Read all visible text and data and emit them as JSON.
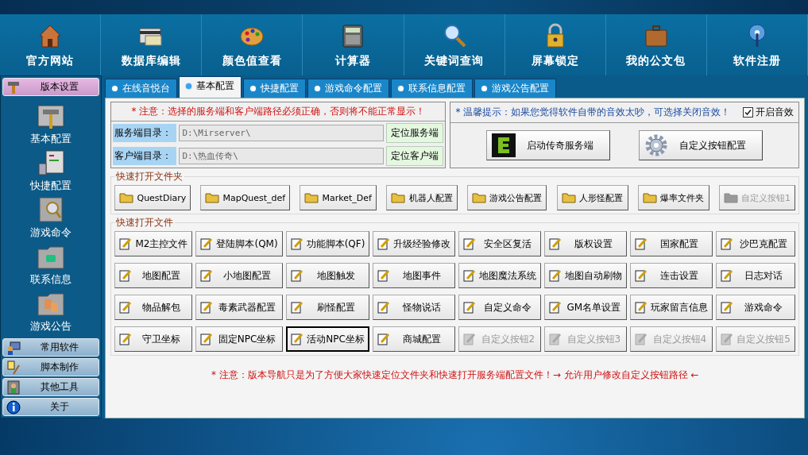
{
  "toolbar": [
    {
      "label": "官方网站",
      "kind": "house"
    },
    {
      "label": "数据库编辑",
      "kind": "card"
    },
    {
      "label": "颜色值查看",
      "kind": "palette"
    },
    {
      "label": "计算器",
      "kind": "calculator"
    },
    {
      "label": "关键词查询",
      "kind": "magnifier"
    },
    {
      "label": "屏幕锁定",
      "kind": "lock"
    },
    {
      "label": "我的公文包",
      "kind": "briefcase"
    },
    {
      "label": "软件注册",
      "kind": "antenna"
    }
  ],
  "sidebar": {
    "groups": [
      {
        "label": "版本设置",
        "kind": "hammer",
        "expanded": true,
        "items": [
          {
            "label": "基本配置",
            "kind": "hammer"
          },
          {
            "label": "快捷配置",
            "kind": "panel"
          },
          {
            "label": "游戏命令",
            "kind": "find"
          },
          {
            "label": "联系信息",
            "kind": "phone"
          },
          {
            "label": "游戏公告",
            "kind": "faces"
          }
        ]
      },
      {
        "label": "常用软件",
        "kind": "computer",
        "expanded": false
      },
      {
        "label": "脚本制作",
        "kind": "note",
        "expanded": false
      },
      {
        "label": "其他工具",
        "kind": "person",
        "expanded": false
      },
      {
        "label": "关于",
        "kind": "info",
        "expanded": false
      }
    ]
  },
  "tabs": [
    {
      "label": "在线音悦台",
      "selected": false
    },
    {
      "label": "基本配置",
      "selected": true
    },
    {
      "label": "快捷配置",
      "selected": false
    },
    {
      "label": "游戏命令配置",
      "selected": false
    },
    {
      "label": "联系信息配置",
      "selected": false
    },
    {
      "label": "游戏公告配置",
      "selected": false
    }
  ],
  "paths": {
    "warning": "* 注意：选择的服务端和客户端路径必须正确，否则将不能正常显示！",
    "rows": [
      {
        "label": "服务端目录：",
        "value": "D:\\Mirserver\\",
        "button": "定位服务端"
      },
      {
        "label": "客户端目录：",
        "value": "D:\\热血传奇\\",
        "button": "定位客户端"
      }
    ]
  },
  "sound": {
    "tip": "* 温馨提示：如果您觉得软件自带的音效太吵，可选择关闭音效！",
    "checkbox": {
      "label": "开启音效",
      "checked": true
    },
    "buttons": [
      {
        "label": "启动传奇服务端",
        "kind": "e-logo"
      },
      {
        "label": "自定义按钮配置",
        "kind": "gear"
      }
    ]
  },
  "folders": {
    "title": "快速打开文件夹",
    "buttons": [
      {
        "label": "QuestDiary",
        "disabled": false
      },
      {
        "label": "MapQuest_def",
        "disabled": false
      },
      {
        "label": "Market_Def",
        "disabled": false
      },
      {
        "label": "机器人配置",
        "disabled": false
      },
      {
        "label": "游戏公告配置",
        "disabled": false
      },
      {
        "label": "人形怪配置",
        "disabled": false
      },
      {
        "label": "爆率文件夹",
        "disabled": false
      },
      {
        "label": "自定义按钮1",
        "disabled": true
      }
    ]
  },
  "files": {
    "title": "快速打开文件",
    "buttons": [
      {
        "label": "M2主控文件",
        "disabled": false,
        "selected": false
      },
      {
        "label": "登陆脚本(QM)",
        "disabled": false,
        "selected": false
      },
      {
        "label": "功能脚本(QF)",
        "disabled": false,
        "selected": false
      },
      {
        "label": "升级经验修改",
        "disabled": false,
        "selected": false
      },
      {
        "label": "安全区复活",
        "disabled": false,
        "selected": false
      },
      {
        "label": "版权设置",
        "disabled": false,
        "selected": false
      },
      {
        "label": "国家配置",
        "disabled": false,
        "selected": false
      },
      {
        "label": "沙巴克配置",
        "disabled": false,
        "selected": false
      },
      {
        "label": "地图配置",
        "disabled": false,
        "selected": false
      },
      {
        "label": "小地图配置",
        "disabled": false,
        "selected": false
      },
      {
        "label": "地图触发",
        "disabled": false,
        "selected": false
      },
      {
        "label": "地图事件",
        "disabled": false,
        "selected": false
      },
      {
        "label": "地图魔法系统",
        "disabled": false,
        "selected": false
      },
      {
        "label": "地图自动刷物",
        "disabled": false,
        "selected": false
      },
      {
        "label": "连击设置",
        "disabled": false,
        "selected": false
      },
      {
        "label": "日志对话",
        "disabled": false,
        "selected": false
      },
      {
        "label": "物品解包",
        "disabled": false,
        "selected": false
      },
      {
        "label": "毒素武器配置",
        "disabled": false,
        "selected": false
      },
      {
        "label": "刷怪配置",
        "disabled": false,
        "selected": false
      },
      {
        "label": "怪物说话",
        "disabled": false,
        "selected": false
      },
      {
        "label": "自定义命令",
        "disabled": false,
        "selected": false
      },
      {
        "label": "GM名单设置",
        "disabled": false,
        "selected": false
      },
      {
        "label": "玩家留言信息",
        "disabled": false,
        "selected": false
      },
      {
        "label": "游戏命令",
        "disabled": false,
        "selected": false
      },
      {
        "label": "守卫坐标",
        "disabled": false,
        "selected": false
      },
      {
        "label": "固定NPC坐标",
        "disabled": false,
        "selected": false
      },
      {
        "label": "活动NPC坐标",
        "disabled": false,
        "selected": true
      },
      {
        "label": "商城配置",
        "disabled": false,
        "selected": false
      },
      {
        "label": "自定义按钮2",
        "disabled": true,
        "selected": false
      },
      {
        "label": "自定义按钮3",
        "disabled": true,
        "selected": false
      },
      {
        "label": "自定义按钮4",
        "disabled": true,
        "selected": false
      },
      {
        "label": "自定义按钮5",
        "disabled": true,
        "selected": false
      }
    ]
  },
  "footer_note": "* 注意：版本导航只是为了方便大家快速定位文件夹和快速打开服务端配置文件！→ 允许用户修改自定义按钮路径 ←"
}
